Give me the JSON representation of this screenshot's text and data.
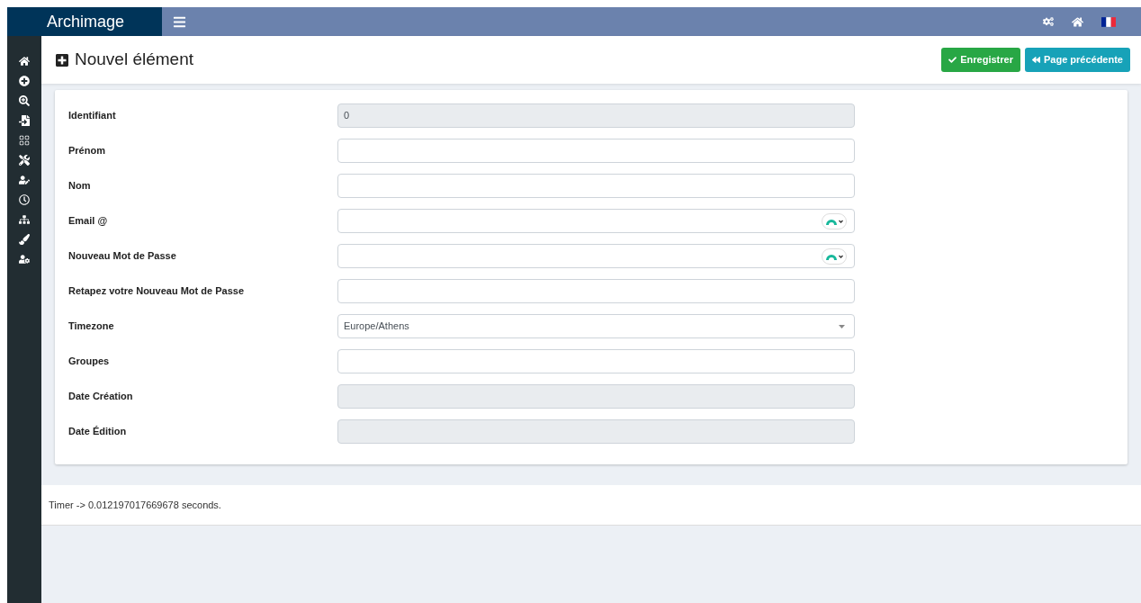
{
  "header": {
    "brand": "Archimage"
  },
  "page": {
    "title": "Nouvel élément"
  },
  "buttons": [
    {
      "label": "Enregistrer",
      "kind": "save"
    },
    {
      "label": "Page précédente",
      "kind": "back"
    }
  ],
  "fields": [
    {
      "label": "Identifiant",
      "kind": "readonly",
      "value": "0"
    },
    {
      "label": "Prénom",
      "kind": "text"
    },
    {
      "label": "Nom",
      "kind": "text"
    },
    {
      "label": "Email @",
      "kind": "addon"
    },
    {
      "label": "Nouveau Mot de Passe",
      "kind": "addon"
    },
    {
      "label": "Retapez votre Nouveau Mot de Passe",
      "kind": "text"
    },
    {
      "label": "Timezone",
      "kind": "select",
      "value": "Europe/Athens"
    },
    {
      "label": "Groupes",
      "kind": "text"
    },
    {
      "label": "Date Création",
      "kind": "readonly"
    },
    {
      "label": "Date Édition",
      "kind": "readonly"
    }
  ],
  "footer": {
    "timer": "Timer -> 0.012197017669678 seconds."
  }
}
